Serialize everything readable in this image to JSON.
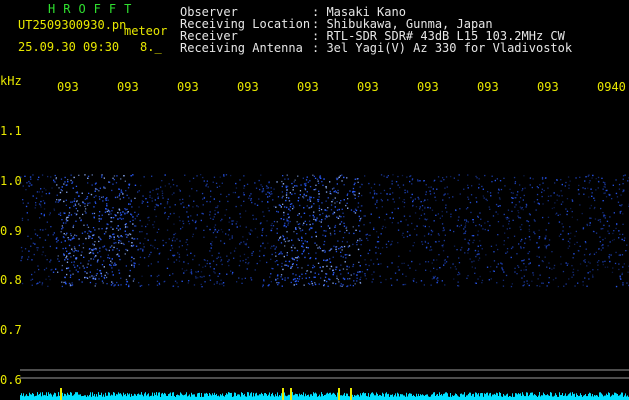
{
  "header": {
    "app_name": "HROFFT",
    "file_name": "UT2509300930.pn",
    "meteor_label": "meteor",
    "datetime": "25.09.30 09:30",
    "count_value": "8._",
    "fields": [
      {
        "label": "Observer",
        "value": ": Masaki Kano"
      },
      {
        "label": "Receiving Location",
        "value": ": Shibukawa, Gunma, Japan"
      },
      {
        "label": "Receiver",
        "value": ": RTL-SDR SDR# 43dB L15 103.2MHz CW"
      },
      {
        "label": "Receiving Antenna",
        "value": ": 3el Yagi(V) Az 330 for Vladivostok"
      }
    ]
  },
  "y_axis": {
    "unit": "kHz",
    "ticks": [
      "1.1",
      "1.0",
      "0.9",
      "0.8",
      "0.7",
      "0.6"
    ]
  },
  "x_axis": {
    "ticks": [
      "093",
      "093",
      "093",
      "093",
      "093",
      "093",
      "093",
      "093",
      "093",
      "0940"
    ]
  },
  "colors": {
    "background": "#000000",
    "text_header": "#e6e6e6",
    "text_yellow": "#e8e800",
    "text_green": "#2fe02f",
    "signal_blue": "#2a5cff",
    "baseline_cyan": "#00e0ff"
  }
}
